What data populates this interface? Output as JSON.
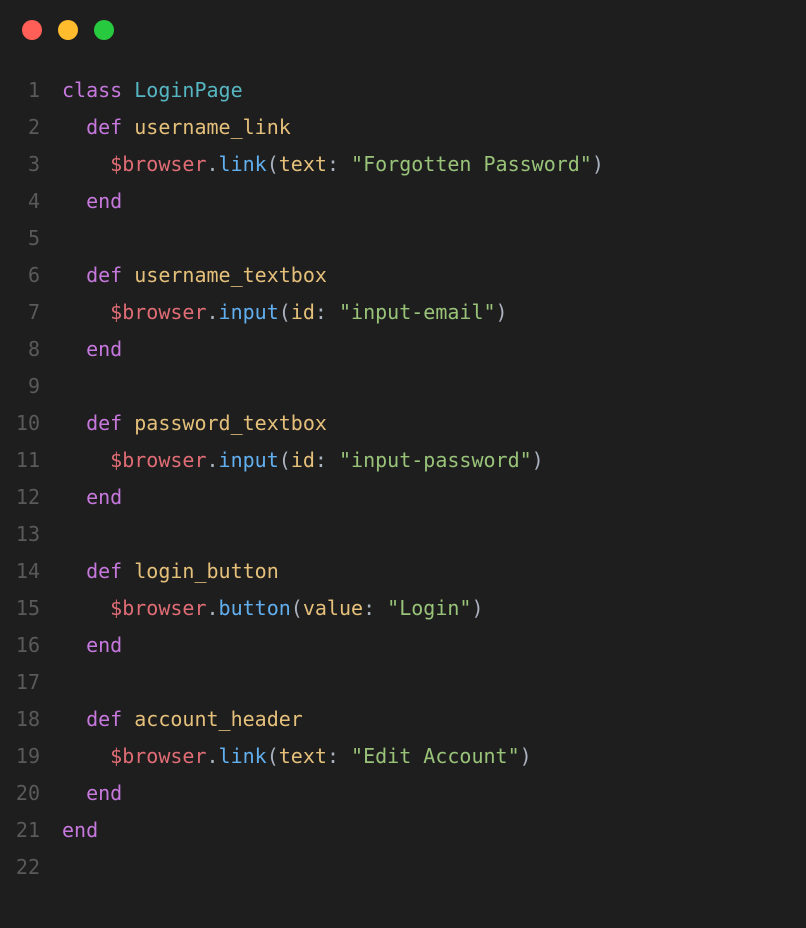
{
  "titlebar": {
    "red": "red",
    "yellow": "yellow",
    "green": "green"
  },
  "gutter": {
    "l1": "1",
    "l2": "2",
    "l3": "3",
    "l4": "4",
    "l5": "5",
    "l6": "6",
    "l7": "7",
    "l8": "8",
    "l9": "9",
    "l10": "10",
    "l11": "11",
    "l12": "12",
    "l13": "13",
    "l14": "14",
    "l15": "15",
    "l16": "16",
    "l17": "17",
    "l18": "18",
    "l19": "19",
    "l20": "20",
    "l21": "21",
    "l22": "22"
  },
  "tok": {
    "class": "class",
    "def": "def",
    "end": "end",
    "LoginPage": "LoginPage",
    "username_link": "username_link",
    "username_textbox": "username_textbox",
    "password_textbox": "password_textbox",
    "login_button": "login_button",
    "account_header": "account_header",
    "browser": "$browser",
    "link": "link",
    "input": "input",
    "button": "button",
    "text": "text",
    "id": "id",
    "value": "value",
    "lparen": "(",
    "rparen": ")",
    "colon": ":",
    "dot": ".",
    "sp": " ",
    "forgotten": "\"Forgotten Password\"",
    "inputEmail": "\"input-email\"",
    "inputPassword": "\"input-password\"",
    "login": "\"Login\"",
    "editAccount": "\"Edit Account\""
  }
}
